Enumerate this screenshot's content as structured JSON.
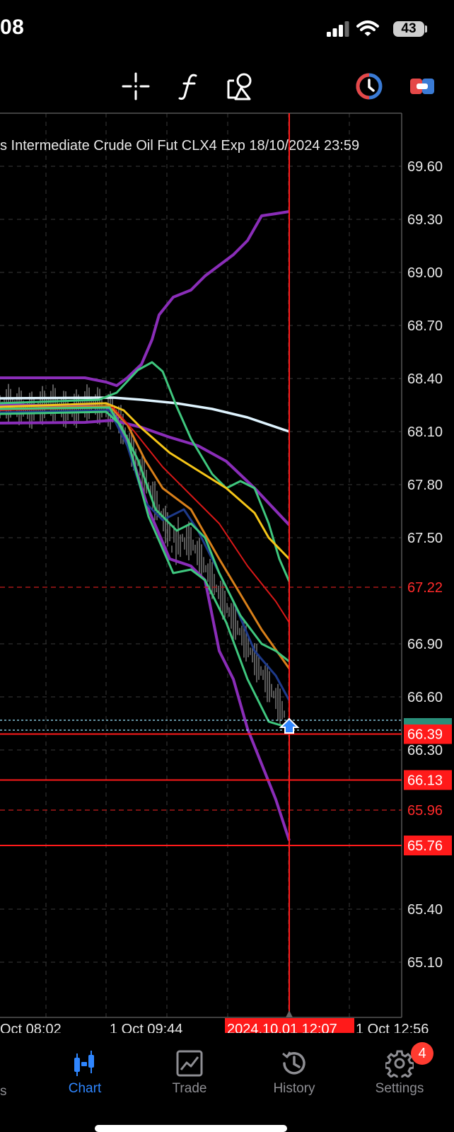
{
  "status_bar": {
    "time": "08",
    "battery": "43",
    "icons": [
      "signal-icon",
      "wifi-icon",
      "battery-icon"
    ]
  },
  "toolbar": {
    "tools": [
      "crosshair-icon",
      "function-icon",
      "objects-icon",
      "timeframe-icon",
      "account-icon"
    ]
  },
  "chart": {
    "title": "s Intermediate Crude Oil Fut CLX4 Exp 18/10/2024 23:59",
    "y_ticks": [
      "69.60",
      "69.30",
      "69.00",
      "68.70",
      "68.40",
      "68.10",
      "67.80",
      "67.50",
      "66.90",
      "66.60",
      "66.30",
      "65.40",
      "65.10"
    ],
    "x_ticks": [
      "Oct 08:02",
      "1 Oct 09:44",
      "1 Oct 12:56"
    ],
    "crosshair_time": "2024.10.01 12:07",
    "price_levels": [
      {
        "value": "67.22",
        "style": "dashed"
      },
      {
        "value": "66.39",
        "style": "solid-tag"
      },
      {
        "value": "66.13",
        "style": "solid-tag"
      },
      {
        "value": "65.96",
        "style": "dashed"
      },
      {
        "value": "65.76",
        "style": "solid-tag"
      }
    ],
    "colors": {
      "crosshair": "#ff1a1a",
      "grid": "#3a3a3a",
      "purple": "#8a2db8",
      "green": "#3fc77e",
      "yellow": "#f5c518",
      "orange": "#d9801a",
      "red": "#d81818",
      "navy": "#1e3a8a",
      "white": "#dff4ff"
    }
  },
  "chart_data": {
    "type": "line",
    "title": "s Intermediate Crude Oil Fut CLX4 Exp 18/10/2024 23:59",
    "xlabel": "",
    "ylabel": "",
    "ylim": [
      64.85,
      69.75
    ],
    "x": [
      "Oct 08:02",
      "1 Oct 09:44",
      "2024.10.01 12:07",
      "1 Oct 12:56"
    ],
    "series": [
      {
        "values_end": [
          69.34,
          67.62,
          65.78
        ]
      },
      {
        "values_end": [
          67.28,
          66.72,
          66.45
        ]
      },
      {
        "values_end": [
          67.4
        ]
      },
      {
        "values_end": [
          66.68
        ]
      },
      {
        "values_end": [
          67.05
        ]
      },
      {
        "values_end": [
          66.58
        ]
      },
      {
        "values_end": [
          68.11
        ]
      }
    ],
    "grid": true
  },
  "nav": {
    "items": [
      {
        "label": "Chart",
        "icon": "candlestick-icon",
        "active": true
      },
      {
        "label": "Trade",
        "icon": "trade-chart-icon",
        "active": false
      },
      {
        "label": "History",
        "icon": "history-icon",
        "active": false
      },
      {
        "label": "Settings",
        "icon": "gear-icon",
        "active": false
      }
    ],
    "settings_badge": "4",
    "cut_off_label": "s"
  }
}
